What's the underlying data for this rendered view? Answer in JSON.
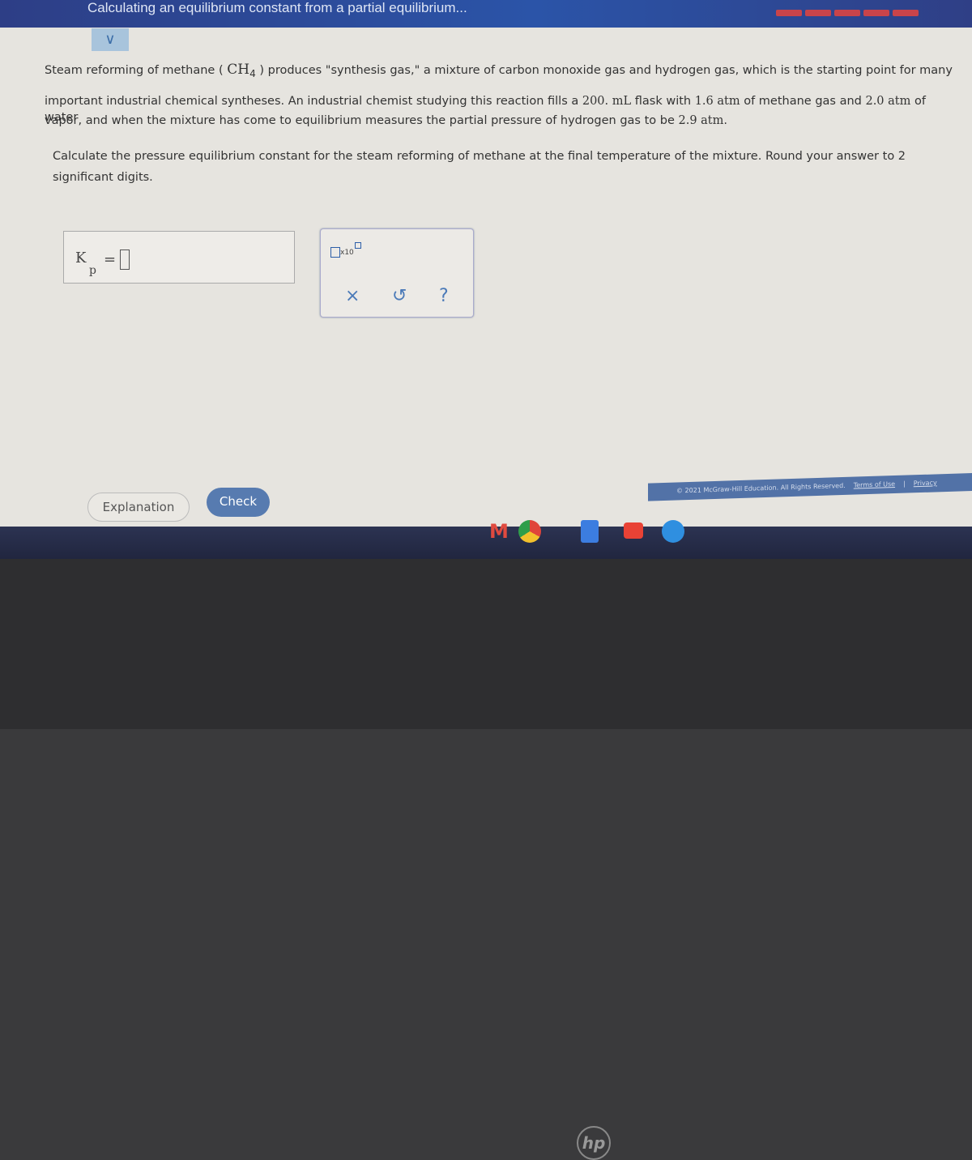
{
  "header": {
    "title": "Calculating an equilibrium constant from a partial equilibrium...",
    "progress_segments": 5,
    "progress_color": "#c9444a"
  },
  "problem": {
    "p1a": "Steam reforming of methane ( ",
    "p1f": "CH",
    "p1sub": "4",
    "p1b": " ) produces \"synthesis gas,\" a mixture of carbon monoxide gas and hydrogen gas, which is the starting point for many",
    "p2a": "important industrial chemical syntheses. An industrial chemist studying this reaction fills a ",
    "p2v": "200. mL",
    "p2b": " flask with ",
    "p2c": "1.6 atm",
    "p2d": " of methane gas and ",
    "p2e": "2.0 atm",
    "p2f": " of water",
    "p3a": "vapor, and when the mixture has come to equilibrium measures the partial pressure of hydrogen gas to be ",
    "p3v": "2.9 atm",
    "p3b": ".",
    "q": "Calculate the pressure equilibrium constant for the steam reforming of methane at the final temperature of the mixture. Round your answer to 2 significant digits."
  },
  "answer": {
    "label": "K",
    "sub": "p",
    "eq": "=",
    "value": ""
  },
  "tools": {
    "x10": "x10",
    "clear": "×",
    "undo": "↺",
    "help": "?"
  },
  "buttons": {
    "explanation": "Explanation",
    "check": "Check"
  },
  "footer": {
    "copyright": "© 2021 McGraw-Hill Education. All Rights Reserved.",
    "terms": "Terms of Use",
    "privacy": "Privacy"
  },
  "laptop": {
    "brand": "hp"
  }
}
